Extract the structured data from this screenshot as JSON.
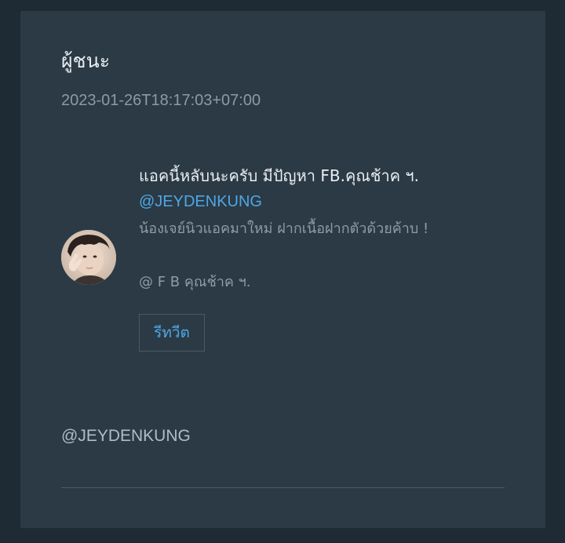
{
  "post": {
    "title": "ผู้ชนะ",
    "timestamp": "2023-01-26T18:17:03+07:00"
  },
  "tweet": {
    "text_line1": "แอคนี้หลับนะครับ มีปัญหา FB.คุณช้าค ฯ.",
    "handle": "@JEYDENKUNG",
    "body": "น้องเจย์นิวแอคมาใหม่ ฝากเนื้อฝากตัวด้วยค้าบ !",
    "signature": "@ F B คุณช้าค ฯ.",
    "retweet_label": "รีทวีต"
  },
  "footer": {
    "handle": "@JEYDENKUNG"
  },
  "colors": {
    "background": "#1f2b34",
    "card": "#2b3a45",
    "link": "#4ea7e6"
  }
}
